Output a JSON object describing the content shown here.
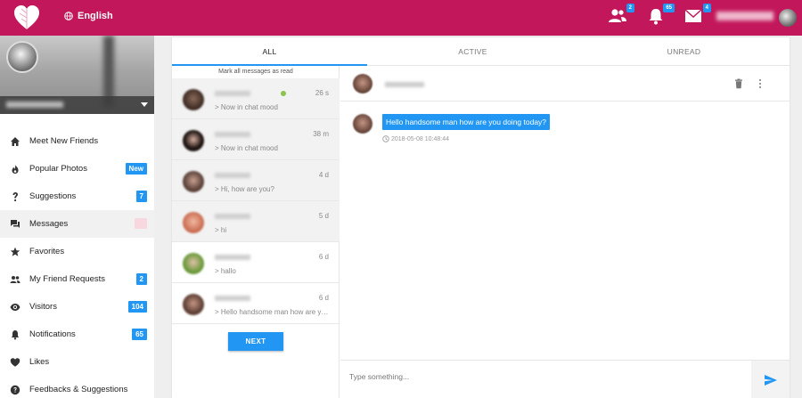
{
  "topbar": {
    "language_label": "English",
    "icons": [
      {
        "name": "friends-icon",
        "badge": "2"
      },
      {
        "name": "bell-icon",
        "badge": "65"
      },
      {
        "name": "mail-icon",
        "badge": "4"
      }
    ],
    "accent_color": "#c2185b"
  },
  "sidebar": {
    "menu": [
      {
        "label": "Meet New Friends",
        "icon": "home-icon",
        "badge": ""
      },
      {
        "label": "Popular Photos",
        "icon": "flame-icon",
        "badge": "New"
      },
      {
        "label": "Suggestions",
        "icon": "question-icon",
        "badge": "7"
      },
      {
        "label": "Messages",
        "icon": "chat-icon",
        "badge": ""
      },
      {
        "label": "Favorites",
        "icon": "star-icon",
        "badge": ""
      },
      {
        "label": "My Friend Requests",
        "icon": "people-icon",
        "badge": "2"
      },
      {
        "label": "Visitors",
        "icon": "eye-icon",
        "badge": "104"
      },
      {
        "label": "Notifications",
        "icon": "bell-icon",
        "badge": "65"
      },
      {
        "label": "Likes",
        "icon": "heart-icon",
        "badge": ""
      },
      {
        "label": "Feedbacks & Suggestions",
        "icon": "help-icon",
        "badge": ""
      }
    ]
  },
  "messages": {
    "tabs": [
      "ALL",
      "ACTIVE",
      "UNREAD"
    ],
    "mark_all_label": "Mark all messages as read",
    "conversations": [
      {
        "time": "26 s",
        "preview": "> Now in chat mood"
      },
      {
        "time": "38 m",
        "preview": "> Now in chat mood"
      },
      {
        "time": "4 d",
        "preview": "> Hi, how are you?"
      },
      {
        "time": "5 d",
        "preview": "> hi"
      },
      {
        "time": "6 d",
        "preview": "> hallo"
      },
      {
        "time": "6 d",
        "preview": "> Hello handsome man how are you doing today?"
      }
    ],
    "next_label": "NEXT"
  },
  "chat": {
    "message_text": "Hello handsome man how are you doing today?",
    "message_time": "2018-05-08 10:48:44",
    "composer_placeholder": "Type something..."
  }
}
